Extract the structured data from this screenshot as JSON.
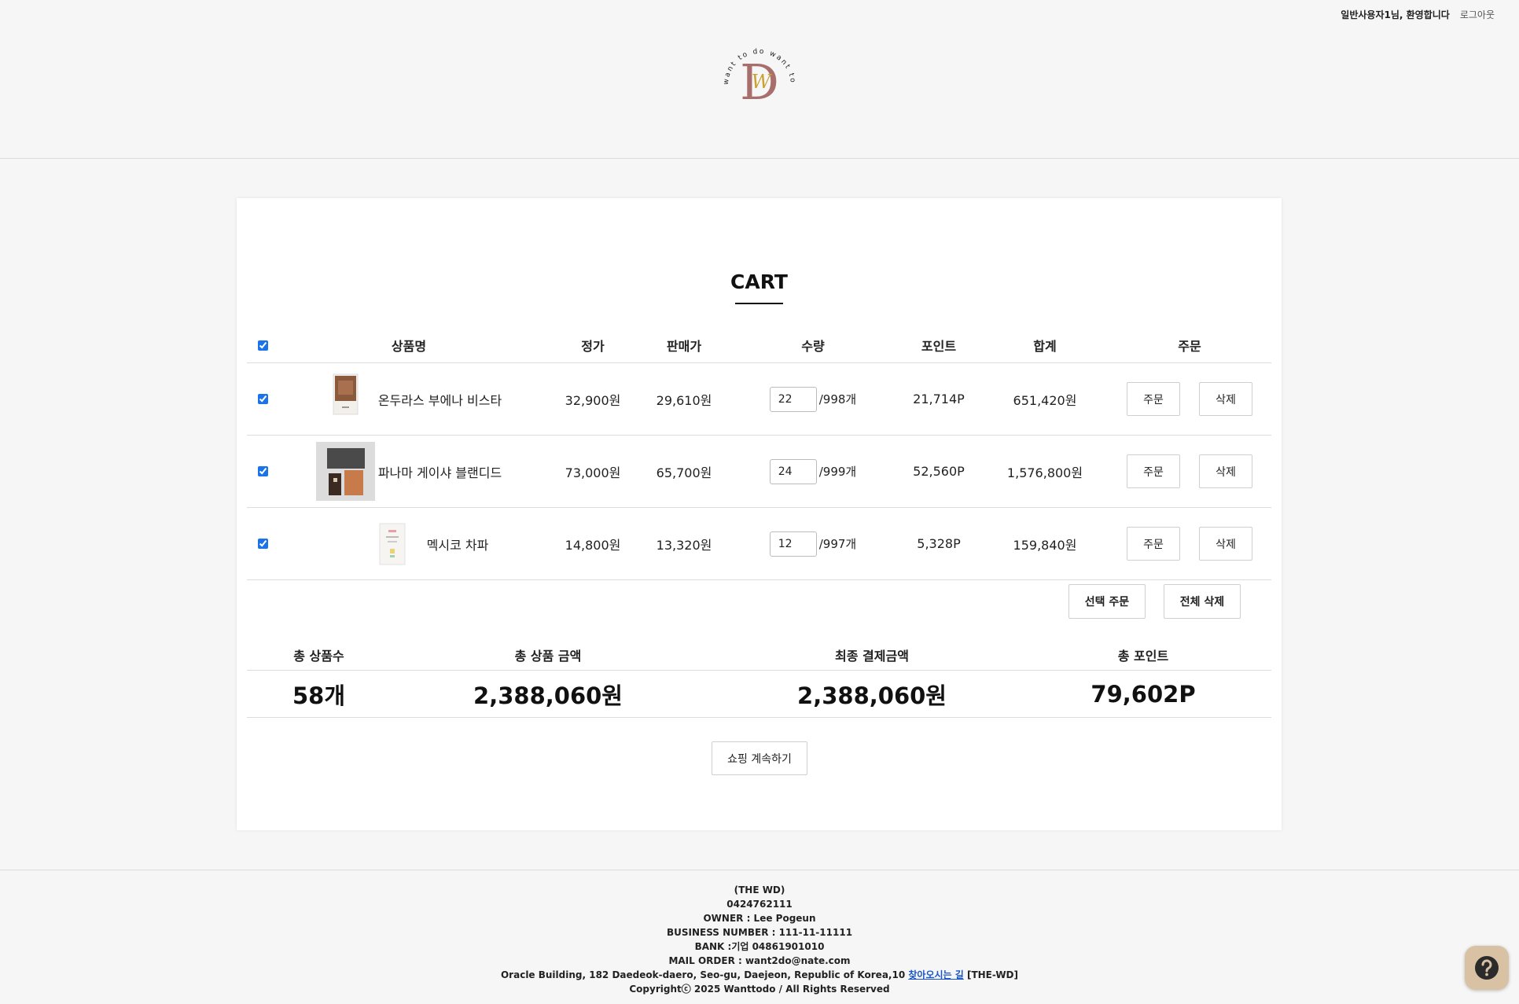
{
  "header": {
    "welcome": "일반사용자1님, 환영합니다",
    "logout": "로그아웃",
    "logo_ring_text": "want to do want to do want to do",
    "logo_mark": "DW"
  },
  "cart": {
    "title": "CART",
    "columns": [
      "상품명",
      "정가",
      "판매가",
      "수량",
      "포인트",
      "합계",
      "주문"
    ],
    "items": [
      {
        "name": "온두라스 부에나 비스타",
        "price": "32,900원",
        "sale": "29,610원",
        "qty": "22",
        "stock": "/998개",
        "point": "21,714P",
        "sum": "651,420원",
        "order": "주문",
        "delete": "삭제"
      },
      {
        "name": "파나마 게이샤 블랜디드",
        "price": "73,000원",
        "sale": "65,700원",
        "qty": "24",
        "stock": "/999개",
        "point": "52,560P",
        "sum": "1,576,800원",
        "order": "주문",
        "delete": "삭제"
      },
      {
        "name": "멕시코 차파",
        "price": "14,800원",
        "sale": "13,320원",
        "qty": "12",
        "stock": "/997개",
        "point": "5,328P",
        "sum": "159,840원",
        "order": "주문",
        "delete": "삭제"
      }
    ],
    "order_selected": "선택 주문",
    "delete_all": "전체 삭제"
  },
  "totals": {
    "labels": [
      "총 상품수",
      "총 상품 금액",
      "최종 결제금액",
      "총 포인트"
    ],
    "values": [
      "58개",
      "2,388,060원",
      "2,388,060원",
      "79,602P"
    ]
  },
  "continue_label": "쇼핑 계속하기",
  "footer": {
    "company": "(THE WD)",
    "phone": "0424762111",
    "owner": "OWNER : Lee Pogeun",
    "business": "BUSINESS NUMBER : 111-11-11111",
    "bank": "BANK :기업 04861901010",
    "mail": "MAIL ORDER : want2do@nate.com",
    "address": "Oracle Building, 182 Daedeok-daero, Seo-gu, Daejeon, Republic of Korea,10",
    "directions_link": "찾아오시는 길",
    "address_suffix": "[THE-WD]",
    "copyright": "Copyrightⓒ 2025 Wanttodo / All Rights Reserved"
  },
  "colors": {
    "accent": "#1a73e8",
    "logo_brown": "#a86e6c",
    "logo_gold": "#c9a233",
    "help_bg": "#d9c2a4"
  },
  "icons": {
    "help": "question-mark-icon"
  }
}
